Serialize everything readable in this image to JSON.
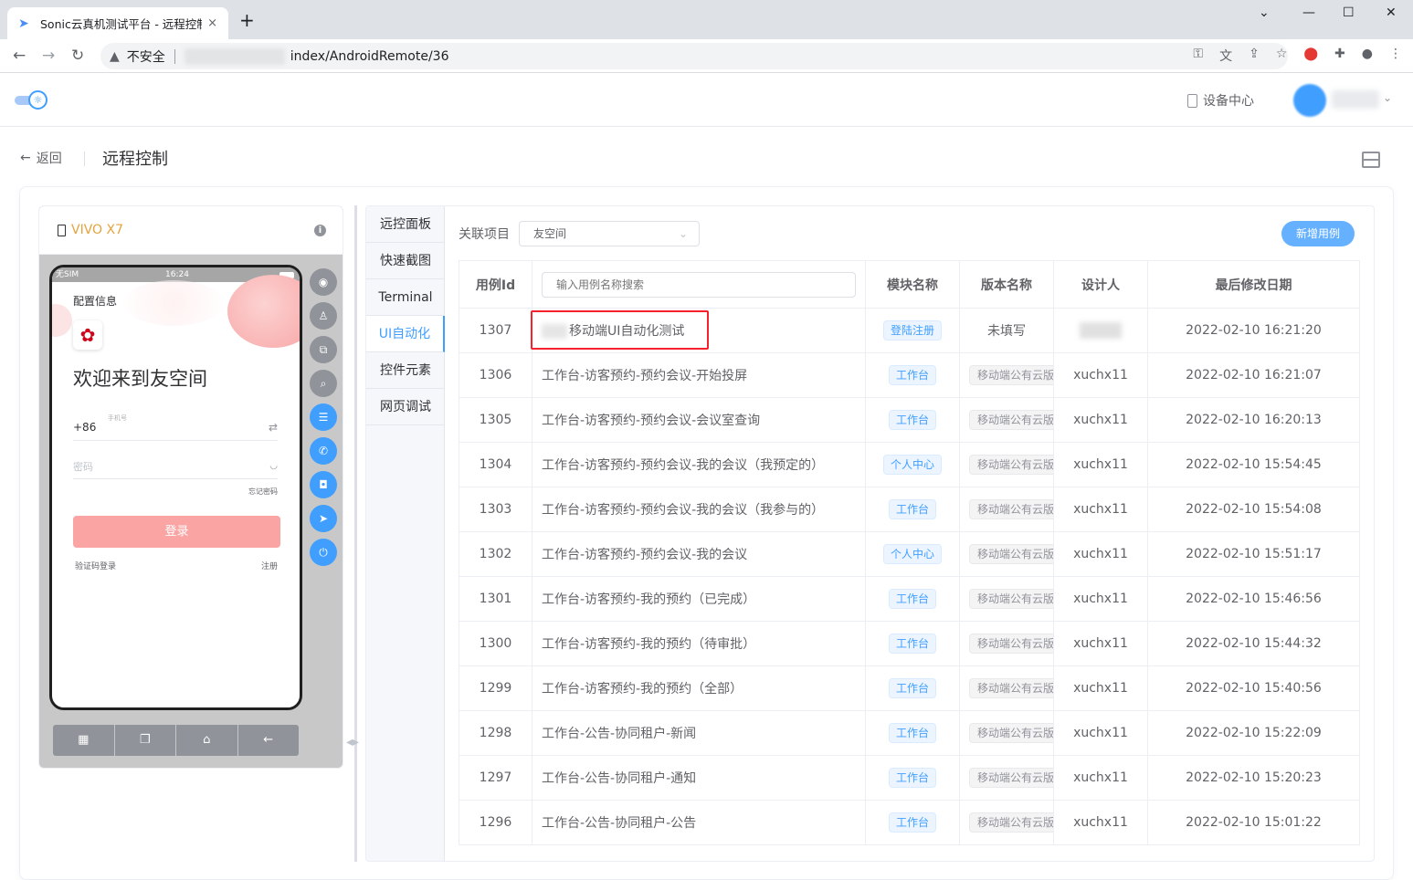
{
  "browser": {
    "tab_title": "Sonic云真机测试平台 - 远程控制",
    "tab_close": "×",
    "new_tab": "+",
    "insecure_label": "不安全",
    "url_path": "index/AndroidRemote/36"
  },
  "header": {
    "device_center": "设备中心"
  },
  "page": {
    "back_label": "返回",
    "title": "远程控制"
  },
  "device": {
    "name": "VIVO X7",
    "info": "i",
    "status_left": "无SIM",
    "status_time": "16:24",
    "screen": {
      "config_info": "配置信息",
      "welcome": "欢迎来到友空间",
      "country_code": "+86",
      "phone_placeholder": "手机号",
      "password_placeholder": "密码",
      "forgot_password": "忘记密码",
      "login_button": "登录",
      "sms_login": "验证码登录",
      "register": "注册"
    },
    "nav_keys": [
      "▦",
      "❐",
      "⌂",
      "←"
    ]
  },
  "tabs": [
    "远控面板",
    "快速截图",
    "Terminal",
    "UI自动化",
    "控件元素",
    "网页调试"
  ],
  "active_tab": "UI自动化",
  "filter": {
    "label": "关联项目",
    "selected_project": "友空间",
    "add_button": "新增用例",
    "search_placeholder": "输入用例名称搜索"
  },
  "table": {
    "headers": {
      "id": "用例Id",
      "module": "模块名称",
      "version": "版本名称",
      "designer": "设计人",
      "modified": "最后修改日期"
    },
    "rows": [
      {
        "id": "1307",
        "name": "移动端UI自动化测试",
        "module": "登陆注册",
        "version": "未填写",
        "designer": "",
        "modified": "2022-02-10 16:21:20"
      },
      {
        "id": "1306",
        "name": "工作台-访客预约-预约会议-开始投屏",
        "module": "工作台",
        "version": "移动端公有云版",
        "designer": "xuchx11",
        "modified": "2022-02-10 16:21:07"
      },
      {
        "id": "1305",
        "name": "工作台-访客预约-预约会议-会议室查询",
        "module": "工作台",
        "version": "移动端公有云版",
        "designer": "xuchx11",
        "modified": "2022-02-10 16:20:13"
      },
      {
        "id": "1304",
        "name": "工作台-访客预约-预约会议-我的会议（我预定的）",
        "module": "个人中心",
        "version": "移动端公有云版",
        "designer": "xuchx11",
        "modified": "2022-02-10 15:54:45"
      },
      {
        "id": "1303",
        "name": "工作台-访客预约-预约会议-我的会议（我参与的）",
        "module": "工作台",
        "version": "移动端公有云版",
        "designer": "xuchx11",
        "modified": "2022-02-10 15:54:08"
      },
      {
        "id": "1302",
        "name": "工作台-访客预约-预约会议-我的会议",
        "module": "个人中心",
        "version": "移动端公有云版",
        "designer": "xuchx11",
        "modified": "2022-02-10 15:51:17"
      },
      {
        "id": "1301",
        "name": "工作台-访客预约-我的预约（已完成）",
        "module": "工作台",
        "version": "移动端公有云版",
        "designer": "xuchx11",
        "modified": "2022-02-10 15:46:56"
      },
      {
        "id": "1300",
        "name": "工作台-访客预约-我的预约（待审批）",
        "module": "工作台",
        "version": "移动端公有云版",
        "designer": "xuchx11",
        "modified": "2022-02-10 15:44:32"
      },
      {
        "id": "1299",
        "name": "工作台-访客预约-我的预约（全部）",
        "module": "工作台",
        "version": "移动端公有云版",
        "designer": "xuchx11",
        "modified": "2022-02-10 15:40:56"
      },
      {
        "id": "1298",
        "name": "工作台-公告-协同租户-新闻",
        "module": "工作台",
        "version": "移动端公有云版",
        "designer": "xuchx11",
        "modified": "2022-02-10 15:22:09"
      },
      {
        "id": "1297",
        "name": "工作台-公告-协同租户-通知",
        "module": "工作台",
        "version": "移动端公有云版",
        "designer": "xuchx11",
        "modified": "2022-02-10 15:20:23"
      },
      {
        "id": "1296",
        "name": "工作台-公告-协同租户-公告",
        "module": "工作台",
        "version": "移动端公有云版",
        "designer": "xuchx11",
        "modified": "2022-02-10 15:01:22"
      }
    ]
  },
  "colors": {
    "accent": "#409eff",
    "highlight_box": "#f5222d",
    "device_name": "#e6a23c",
    "login_button": "#fba4a4"
  }
}
